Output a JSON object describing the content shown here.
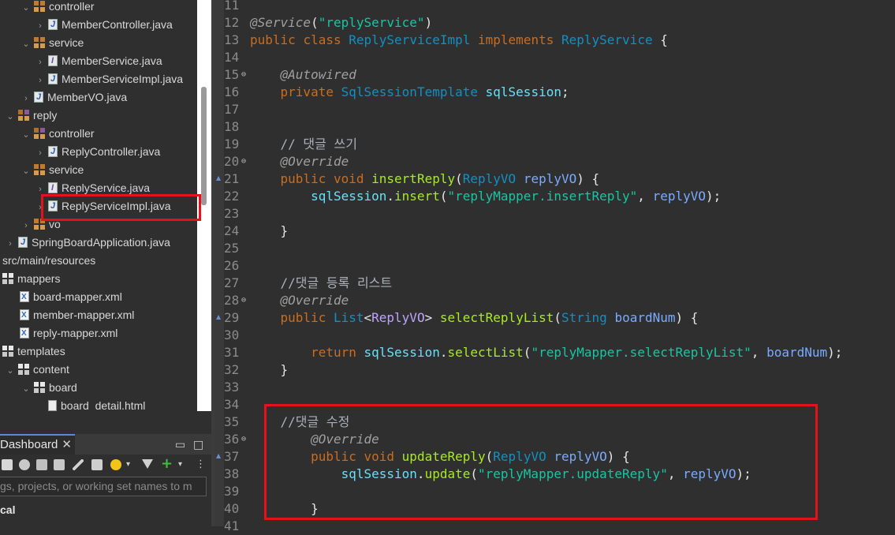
{
  "explorer": {
    "items": [
      {
        "label": "controller"
      },
      {
        "label": "MemberController.java"
      },
      {
        "label": "service"
      },
      {
        "label": "MemberService.java"
      },
      {
        "label": "MemberServiceImpl.java"
      },
      {
        "label": "MemberVO.java"
      },
      {
        "label": "reply"
      },
      {
        "label": "controller"
      },
      {
        "label": "ReplyController.java"
      },
      {
        "label": "service"
      },
      {
        "label": "ReplyService.java"
      },
      {
        "label": "ReplyServiceImpl.java"
      },
      {
        "label": "vo"
      },
      {
        "label": "SpringBoardApplication.java"
      },
      {
        "label": "src/main/resources"
      },
      {
        "label": "mappers"
      },
      {
        "label": "board-mapper.xml"
      },
      {
        "label": "member-mapper.xml"
      },
      {
        "label": "reply-mapper.xml"
      },
      {
        "label": "templates"
      },
      {
        "label": "content"
      },
      {
        "label": "board"
      },
      {
        "label": "board_detail.html"
      }
    ]
  },
  "dashboard": {
    "tab_label": "Dashboard",
    "close_glyph": "✕",
    "minimize_glyph": "▭",
    "maximize_glyph": "□",
    "filter_placeholder": "gs, projects, or working set names to m",
    "local_label": "cal"
  },
  "editor": {
    "line_numbers": [
      "11",
      "12",
      "13",
      "14",
      "15",
      "16",
      "17",
      "18",
      "19",
      "20",
      "21",
      "22",
      "23",
      "24",
      "25",
      "26",
      "27",
      "28",
      "29",
      "30",
      "31",
      "32",
      "33",
      "34",
      "35",
      "36",
      "37",
      "38",
      "39",
      "40",
      "41"
    ],
    "annotation_service": "@Service",
    "service_name": "\"replyService\"",
    "kw_public": "public",
    "kw_class": "class",
    "class_name": "ReplyServiceImpl",
    "kw_implements": "implements",
    "iface_name": "ReplyService",
    "annotation_autowired": "@Autowired",
    "kw_private": "private",
    "type_template": "SqlSessionTemplate",
    "field_session": "sqlSession",
    "comment_write": "// 댓글 쓰기",
    "annotation_override": "@Override",
    "kw_void": "void",
    "m_insert": "insertReply",
    "type_replyvo": "ReplyVO",
    "var_replyvo": "replyVO",
    "call_insert": "insert",
    "str_insert": "\"replyMapper.insertReply\"",
    "comment_list": "//댓글 등록 리스트",
    "type_list": "List",
    "m_select": "selectReplyList",
    "type_string": "String",
    "var_boardnum": "boardNum",
    "kw_return": "return",
    "call_selectlist": "selectList",
    "str_select": "\"replyMapper.selectReplyList\"",
    "comment_update": "//댓글 수정",
    "m_update": "updateReply",
    "call_update": "update",
    "str_update": "\"replyMapper.updateReply\""
  }
}
